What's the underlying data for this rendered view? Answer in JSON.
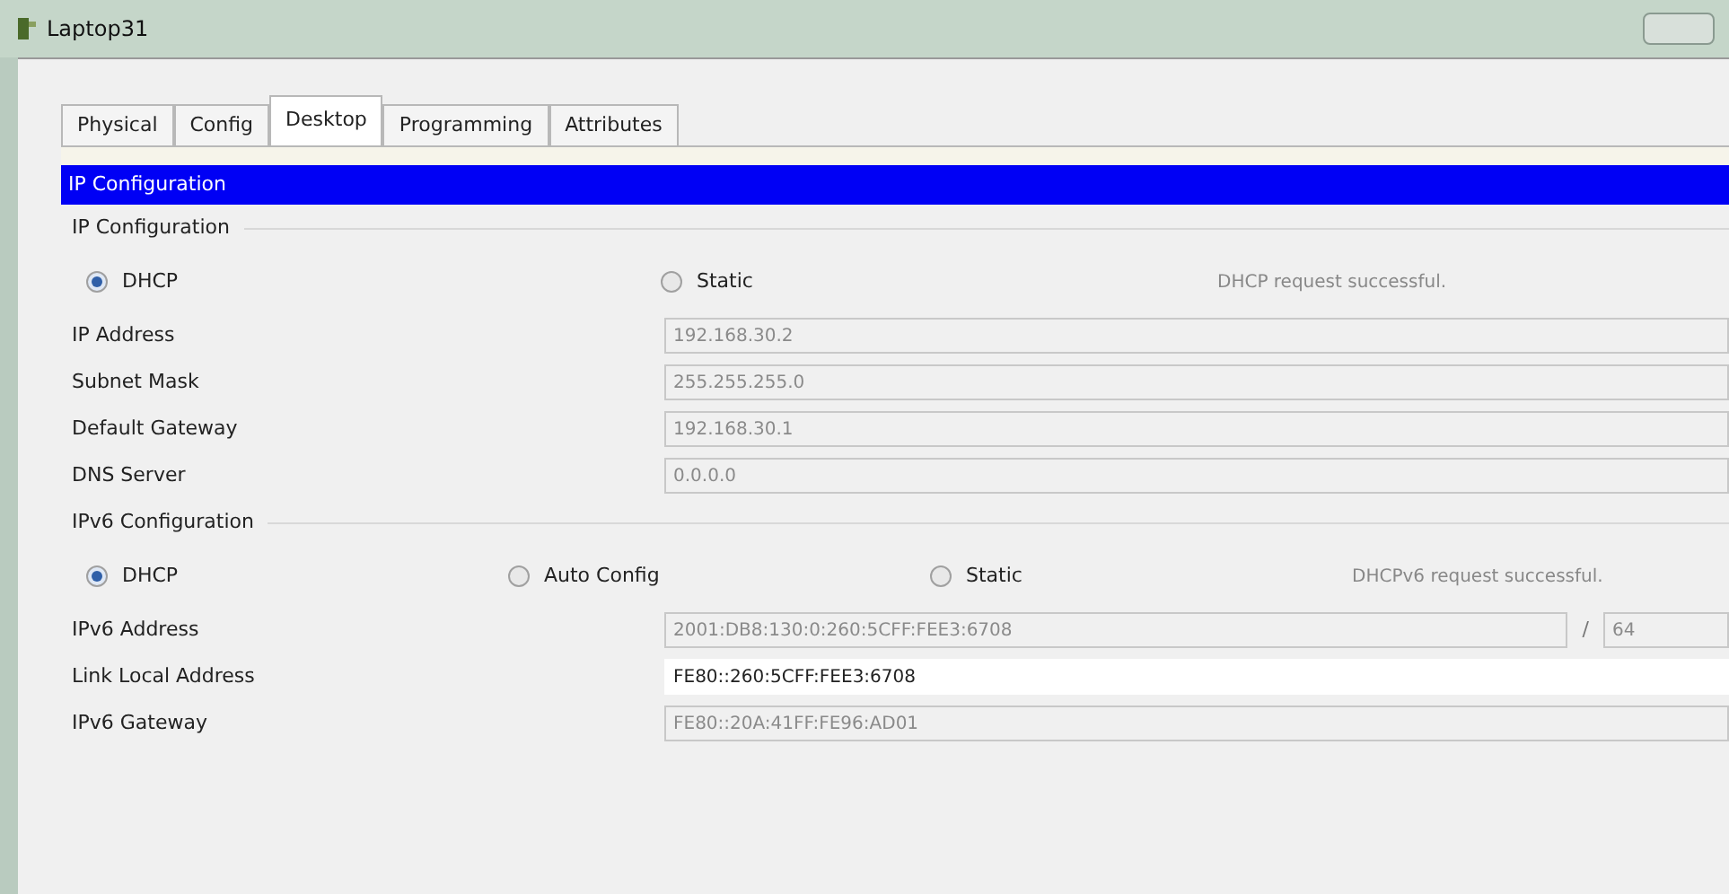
{
  "window": {
    "title": "Laptop31"
  },
  "tabs": [
    {
      "label": "Physical",
      "selected": false
    },
    {
      "label": "Config",
      "selected": false
    },
    {
      "label": "Desktop",
      "selected": true
    },
    {
      "label": "Programming",
      "selected": false
    },
    {
      "label": "Attributes",
      "selected": false
    }
  ],
  "panel_title": "IP Configuration",
  "ipv4": {
    "title": "IP Configuration",
    "modes": [
      {
        "label": "DHCP",
        "selected": true
      },
      {
        "label": "Static",
        "selected": false
      }
    ],
    "status": "DHCP request successful.",
    "fields": [
      {
        "label": "IP Address",
        "value": "192.168.30.2",
        "disabled": true
      },
      {
        "label": "Subnet Mask",
        "value": "255.255.255.0",
        "disabled": true
      },
      {
        "label": "Default Gateway",
        "value": "192.168.30.1",
        "disabled": true
      },
      {
        "label": "DNS Server",
        "value": "0.0.0.0",
        "disabled": true
      }
    ]
  },
  "ipv6": {
    "title": "IPv6 Configuration",
    "modes": [
      {
        "label": "DHCP",
        "selected": true
      },
      {
        "label": "Auto Config",
        "selected": false
      },
      {
        "label": "Static",
        "selected": false
      }
    ],
    "status": "DHCPv6 request successful.",
    "fields": [
      {
        "label": "IPv6 Address",
        "value": "2001:DB8:130:0:260:5CFF:FEE3:6708",
        "disabled": true,
        "separator": "/",
        "prefix": "64"
      },
      {
        "label": "Link Local Address",
        "value": "FE80::260:5CFF:FEE3:6708",
        "disabled": false
      },
      {
        "label": "IPv6 Gateway",
        "value": "FE80::20A:41FF:FE96:AD01",
        "disabled": true
      }
    ]
  }
}
